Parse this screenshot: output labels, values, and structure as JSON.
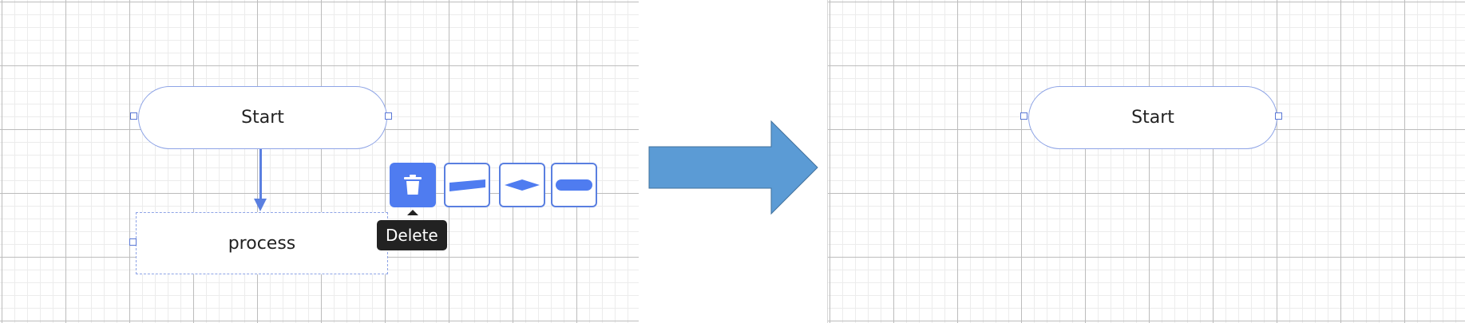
{
  "before": {
    "start_node": {
      "label": "Start"
    },
    "process_node": {
      "label": "process"
    },
    "toolbar": {
      "delete_icon": "trash-icon",
      "shape_icons": [
        "parallelogram-shape-icon",
        "diamond-shape-icon",
        "terminal-shape-icon"
      ]
    },
    "tooltip": {
      "text": "Delete"
    }
  },
  "arrow": {
    "color": "#5b9bd5"
  },
  "after": {
    "start_node": {
      "label": "Start"
    }
  },
  "colors": {
    "accent": "#4f7cf0",
    "node_border": "#8ea4e6",
    "grid_major": "#bcbcbc",
    "grid_minor": "#ececec"
  }
}
